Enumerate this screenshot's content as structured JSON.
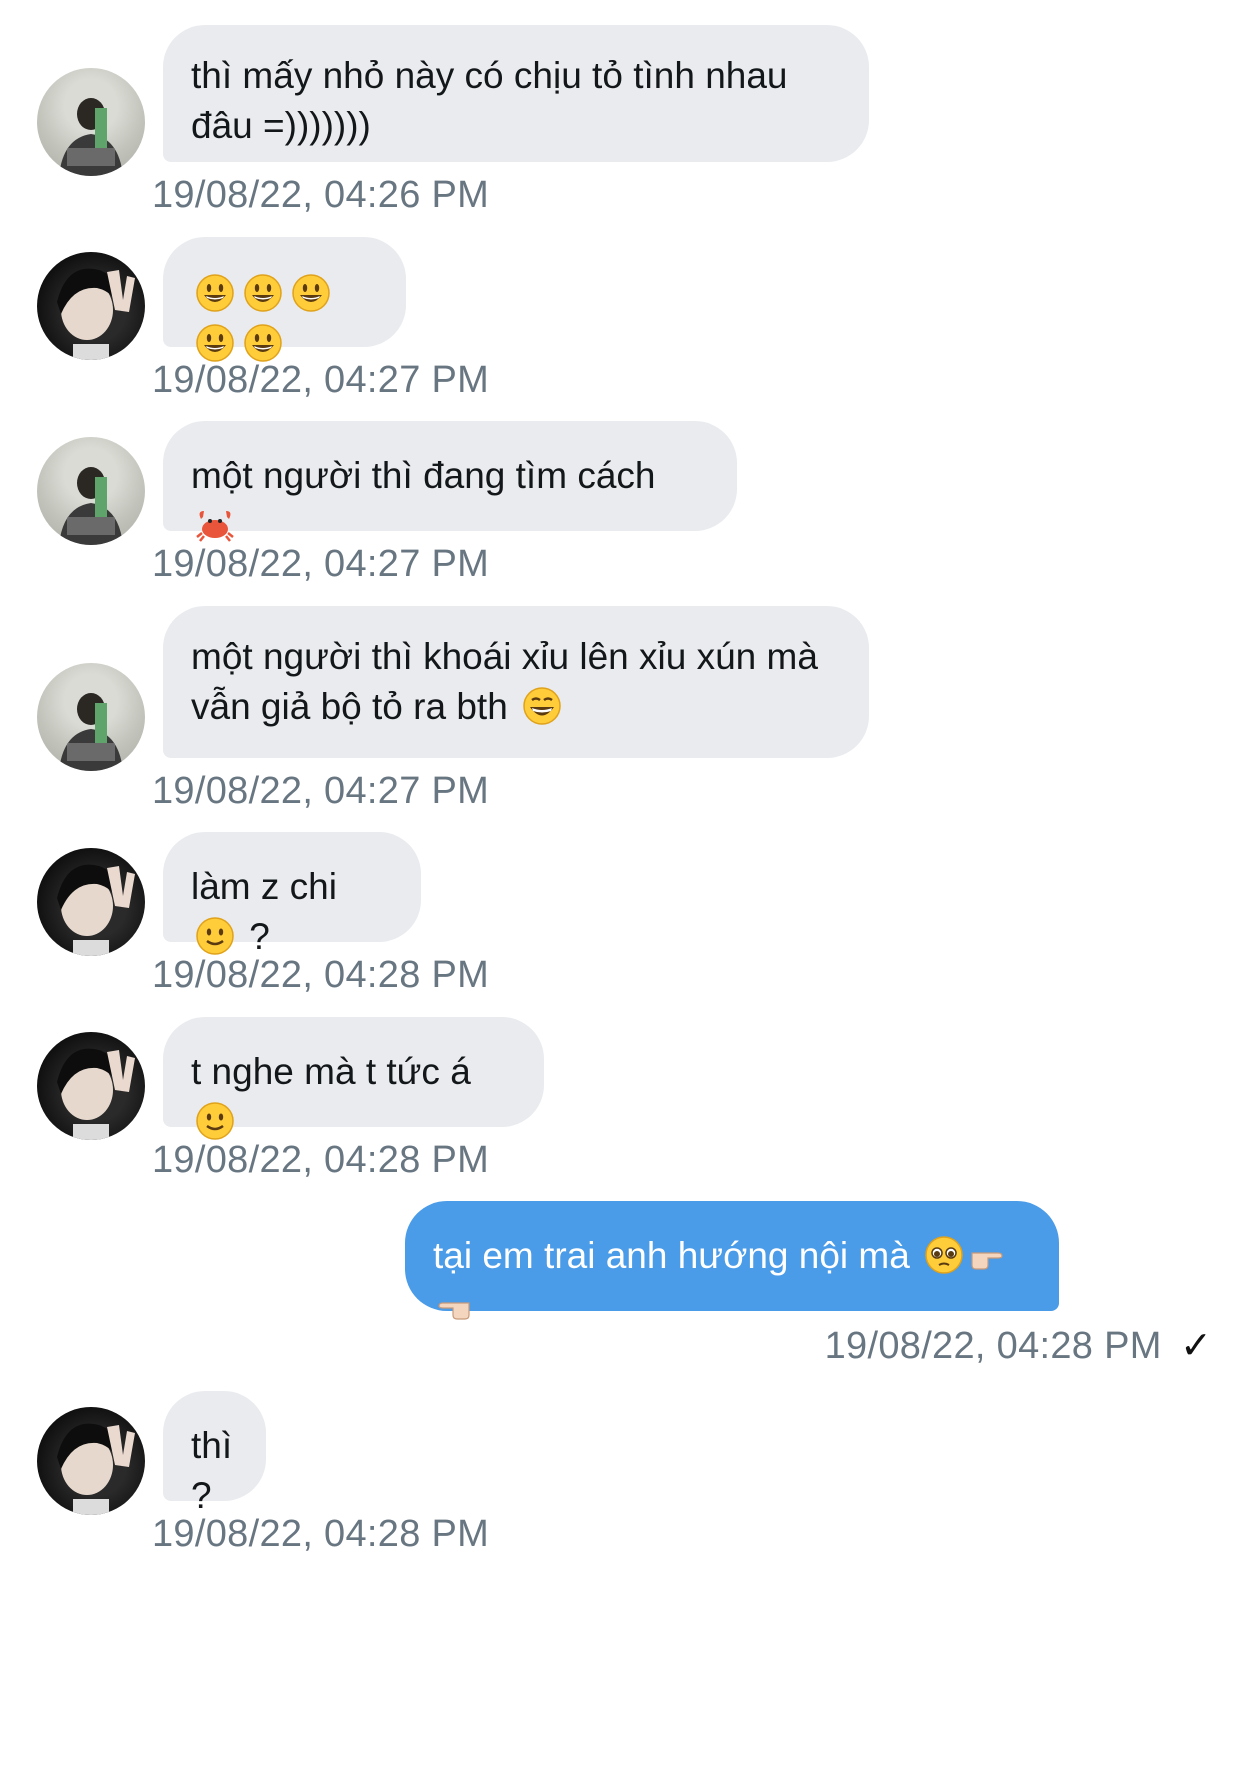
{
  "messages": [
    {
      "id": "m1",
      "text": "thì mấy nhỏ này có chịu tỏ tình nhau đâu =)))))))",
      "time": "19/08/22, 04:26 PM"
    },
    {
      "id": "m2",
      "text": "",
      "emoji": [
        "grinning-face-icon",
        "grinning-face-icon",
        "grinning-face-icon",
        "grinning-face-icon",
        "grinning-face-icon"
      ],
      "time": "19/08/22, 04:27 PM"
    },
    {
      "id": "m3",
      "text": "một người thì đang tìm cách",
      "emoji": [
        "crab-icon"
      ],
      "time": "19/08/22, 04:27 PM"
    },
    {
      "id": "m4",
      "text_line1": "một người thì khoái xỉu lên xỉu xún mà",
      "text_line2": "vẫn giả bộ tỏ ra bth",
      "emoji": [
        "grinning-squinting-face-icon"
      ],
      "time": "19/08/22, 04:27 PM"
    },
    {
      "id": "m5",
      "text": "làm z chi",
      "emoji": [
        "slightly-smiling-face-icon"
      ],
      "suffix": "?",
      "time": "19/08/22, 04:28 PM"
    },
    {
      "id": "m6",
      "text": "t nghe mà t tức á",
      "emoji": [
        "slightly-smiling-face-icon"
      ],
      "time": "19/08/22, 04:28 PM"
    },
    {
      "id": "m7",
      "text": "tại em trai anh hướng nội mà",
      "emoji": [
        "pleading-face-icon",
        "pointing-right-icon",
        "pointing-left-icon"
      ],
      "time": "19/08/22, 04:28 PM",
      "outgoing": true,
      "status": "✓"
    },
    {
      "id": "m8",
      "text": "thì ?",
      "time": "19/08/22, 04:28 PM"
    }
  ],
  "colors": {
    "incoming_bubble": "#e9ebef",
    "outgoing_bubble": "#4a9be8",
    "timestamp": "#687682"
  }
}
